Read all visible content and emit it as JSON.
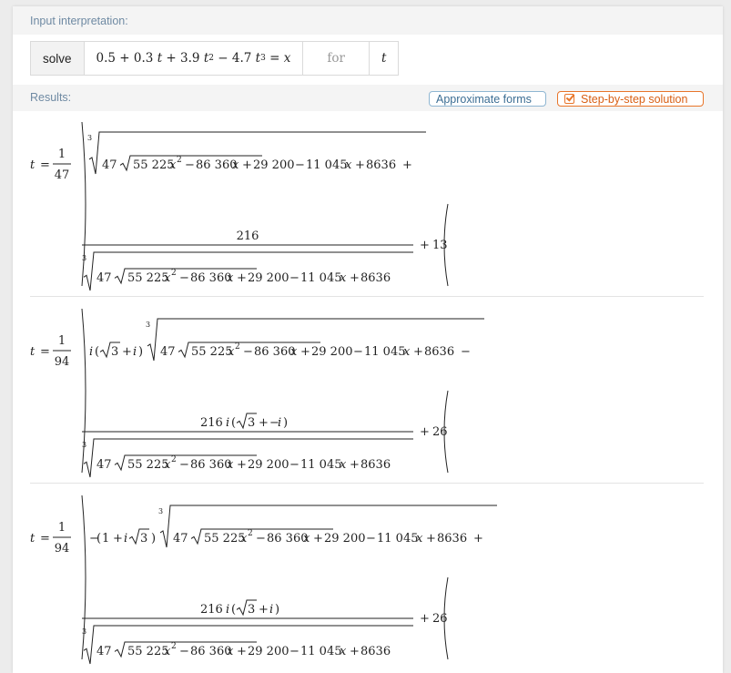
{
  "input_section": {
    "title": "Input interpretation:",
    "solve_label": "solve",
    "equation": {
      "c0": "0.5",
      "c1": "0.3",
      "c2": "3.9",
      "c3": "4.7",
      "var": "t",
      "rhs": "x",
      "exp2": "2",
      "exp3": "3"
    },
    "for_label": "for",
    "for_var": "t"
  },
  "results_section": {
    "title": "Results:",
    "approx_button": "Approximate forms",
    "step_button": "Step-by-step solution"
  },
  "common": {
    "t": "t",
    "eq": "=",
    "one": "1",
    "cube_index": "3",
    "k47": "47",
    "r1": "55 225",
    "r2": "86 360",
    "r3": "29 200",
    "l1": "11 045",
    "l2": "8636",
    "x": "x",
    "two": "2",
    "i": "i",
    "three": "3",
    "plus": "+",
    "minus": "−"
  },
  "solutions": [
    {
      "denom": "47",
      "numerator": "216",
      "add_const": "13"
    },
    {
      "denom": "94",
      "numerator": "216",
      "add_const": "26"
    },
    {
      "denom": "94",
      "numerator": "216",
      "add_const": "26"
    }
  ]
}
